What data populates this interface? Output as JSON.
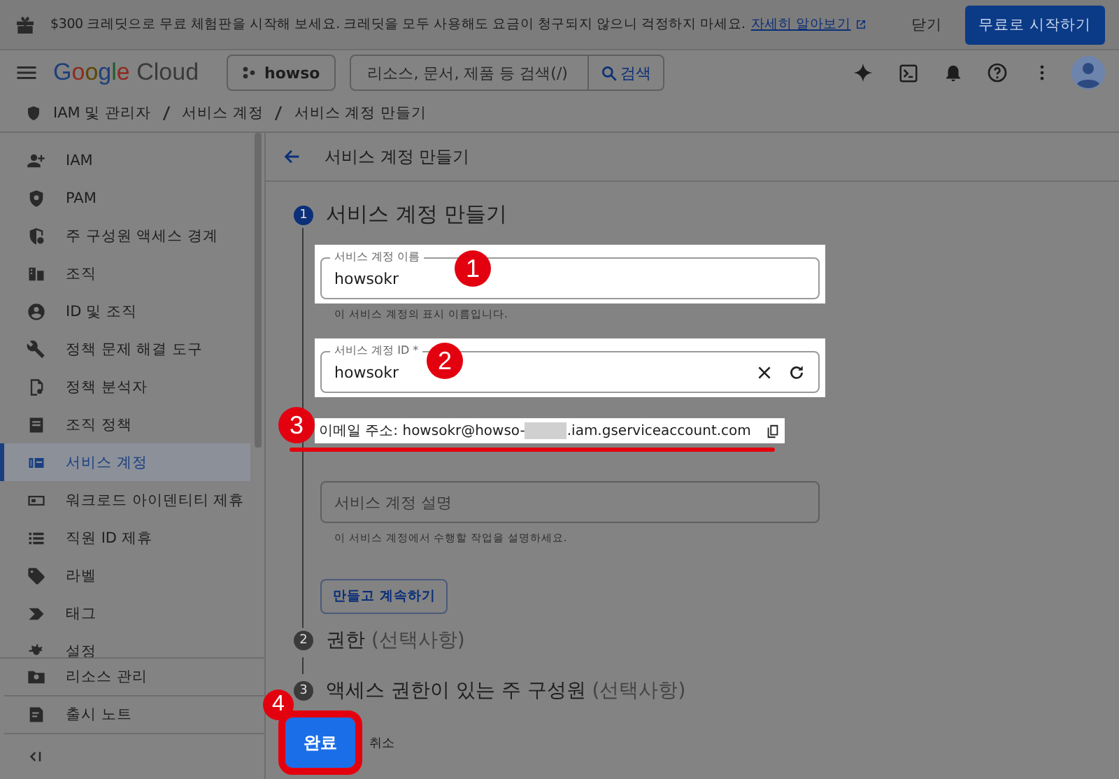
{
  "banner": {
    "text": "$300 크레딧으로 무료 체험판을 시작해 보세요. 크레딧을 모두 사용해도 요금이 청구되지 않으니 걱정하지 마세요.",
    "link": "자세히 알아보기",
    "dismiss": "닫기",
    "cta": "무료로 시작하기"
  },
  "topbar": {
    "brand": "Google",
    "product": "Cloud",
    "project": "howso",
    "search": {
      "placeholder": "리소스, 문서, 제품 등 검색(/)",
      "button": "검색"
    }
  },
  "breadcrumb": [
    "IAM 및 관리자",
    "서비스 계정",
    "서비스 계정 만들기"
  ],
  "sidebar": {
    "items": [
      {
        "label": "IAM",
        "selected": false
      },
      {
        "label": "PAM",
        "selected": false
      },
      {
        "label": "주 구성원 액세스 경계",
        "selected": false
      },
      {
        "label": "조직",
        "selected": false
      },
      {
        "label": "ID 및 조직",
        "selected": false
      },
      {
        "label": "정책 문제 해결 도구",
        "selected": false
      },
      {
        "label": "정책 분석자",
        "selected": false
      },
      {
        "label": "조직 정책",
        "selected": false
      },
      {
        "label": "서비스 계정",
        "selected": true
      },
      {
        "label": "워크로드 아이덴티티 제휴",
        "selected": false
      },
      {
        "label": "직원 ID 제휴",
        "selected": false
      },
      {
        "label": "라벨",
        "selected": false
      },
      {
        "label": "태그",
        "selected": false
      },
      {
        "label": "설정",
        "selected": false
      }
    ],
    "footer": [
      "리소스 관리",
      "출시 노트"
    ]
  },
  "page_title": "서비스 계정 만들기",
  "steps": [
    {
      "number": "1",
      "title": "서비스 계정 만들기",
      "active": true,
      "fields": [
        {
          "kind": "text",
          "label": "서비스 계정 이름",
          "value": "howsokr",
          "helper": "이 서비스 계정의 표시 이름입니다.",
          "highlighted": true
        },
        {
          "kind": "id",
          "label": "서비스 계정 ID *",
          "value": "howsokr",
          "highlighted": true
        },
        {
          "kind": "email",
          "prefix": "이메일 주소: howsokr@howso-",
          "suffix": ".iam.gserviceaccount.com",
          "highlighted": true
        },
        {
          "kind": "text",
          "placeholder": "서비스 계정 설명",
          "helper": "이 서비스 계정에서 수행할 작업을 설명하세요.",
          "highlighted": false
        }
      ],
      "button": "만들고 계속하기"
    },
    {
      "number": "2",
      "title": "권한",
      "note": "(선택사항)",
      "active": false
    },
    {
      "number": "3",
      "title": "액세스 권한이 있는 주 구성원",
      "note": "(선택사항)",
      "active": false
    }
  ],
  "actions": {
    "done": "완료",
    "cancel": "취소"
  },
  "annotations": [
    "1",
    "2",
    "3",
    "4"
  ]
}
